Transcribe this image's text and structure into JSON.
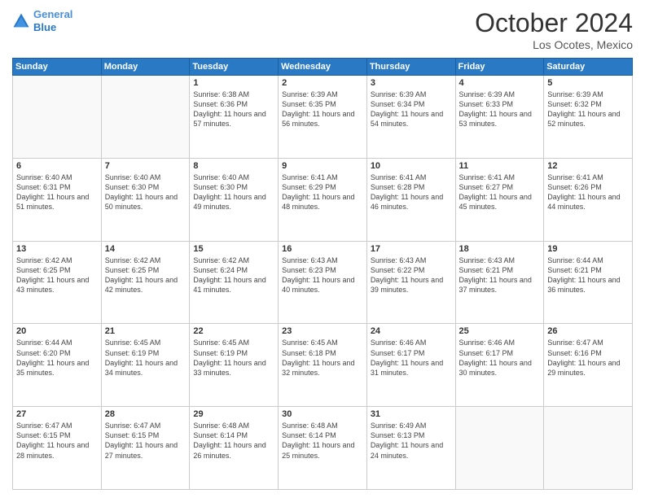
{
  "logo": {
    "line1": "General",
    "line2": "Blue"
  },
  "title": "October 2024",
  "location": "Los Ocotes, Mexico",
  "headers": [
    "Sunday",
    "Monday",
    "Tuesday",
    "Wednesday",
    "Thursday",
    "Friday",
    "Saturday"
  ],
  "weeks": [
    [
      {
        "day": "",
        "info": ""
      },
      {
        "day": "",
        "info": ""
      },
      {
        "day": "1",
        "info": "Sunrise: 6:38 AM\nSunset: 6:36 PM\nDaylight: 11 hours and 57 minutes."
      },
      {
        "day": "2",
        "info": "Sunrise: 6:39 AM\nSunset: 6:35 PM\nDaylight: 11 hours and 56 minutes."
      },
      {
        "day": "3",
        "info": "Sunrise: 6:39 AM\nSunset: 6:34 PM\nDaylight: 11 hours and 54 minutes."
      },
      {
        "day": "4",
        "info": "Sunrise: 6:39 AM\nSunset: 6:33 PM\nDaylight: 11 hours and 53 minutes."
      },
      {
        "day": "5",
        "info": "Sunrise: 6:39 AM\nSunset: 6:32 PM\nDaylight: 11 hours and 52 minutes."
      }
    ],
    [
      {
        "day": "6",
        "info": "Sunrise: 6:40 AM\nSunset: 6:31 PM\nDaylight: 11 hours and 51 minutes."
      },
      {
        "day": "7",
        "info": "Sunrise: 6:40 AM\nSunset: 6:30 PM\nDaylight: 11 hours and 50 minutes."
      },
      {
        "day": "8",
        "info": "Sunrise: 6:40 AM\nSunset: 6:30 PM\nDaylight: 11 hours and 49 minutes."
      },
      {
        "day": "9",
        "info": "Sunrise: 6:41 AM\nSunset: 6:29 PM\nDaylight: 11 hours and 48 minutes."
      },
      {
        "day": "10",
        "info": "Sunrise: 6:41 AM\nSunset: 6:28 PM\nDaylight: 11 hours and 46 minutes."
      },
      {
        "day": "11",
        "info": "Sunrise: 6:41 AM\nSunset: 6:27 PM\nDaylight: 11 hours and 45 minutes."
      },
      {
        "day": "12",
        "info": "Sunrise: 6:41 AM\nSunset: 6:26 PM\nDaylight: 11 hours and 44 minutes."
      }
    ],
    [
      {
        "day": "13",
        "info": "Sunrise: 6:42 AM\nSunset: 6:25 PM\nDaylight: 11 hours and 43 minutes."
      },
      {
        "day": "14",
        "info": "Sunrise: 6:42 AM\nSunset: 6:25 PM\nDaylight: 11 hours and 42 minutes."
      },
      {
        "day": "15",
        "info": "Sunrise: 6:42 AM\nSunset: 6:24 PM\nDaylight: 11 hours and 41 minutes."
      },
      {
        "day": "16",
        "info": "Sunrise: 6:43 AM\nSunset: 6:23 PM\nDaylight: 11 hours and 40 minutes."
      },
      {
        "day": "17",
        "info": "Sunrise: 6:43 AM\nSunset: 6:22 PM\nDaylight: 11 hours and 39 minutes."
      },
      {
        "day": "18",
        "info": "Sunrise: 6:43 AM\nSunset: 6:21 PM\nDaylight: 11 hours and 37 minutes."
      },
      {
        "day": "19",
        "info": "Sunrise: 6:44 AM\nSunset: 6:21 PM\nDaylight: 11 hours and 36 minutes."
      }
    ],
    [
      {
        "day": "20",
        "info": "Sunrise: 6:44 AM\nSunset: 6:20 PM\nDaylight: 11 hours and 35 minutes."
      },
      {
        "day": "21",
        "info": "Sunrise: 6:45 AM\nSunset: 6:19 PM\nDaylight: 11 hours and 34 minutes."
      },
      {
        "day": "22",
        "info": "Sunrise: 6:45 AM\nSunset: 6:19 PM\nDaylight: 11 hours and 33 minutes."
      },
      {
        "day": "23",
        "info": "Sunrise: 6:45 AM\nSunset: 6:18 PM\nDaylight: 11 hours and 32 minutes."
      },
      {
        "day": "24",
        "info": "Sunrise: 6:46 AM\nSunset: 6:17 PM\nDaylight: 11 hours and 31 minutes."
      },
      {
        "day": "25",
        "info": "Sunrise: 6:46 AM\nSunset: 6:17 PM\nDaylight: 11 hours and 30 minutes."
      },
      {
        "day": "26",
        "info": "Sunrise: 6:47 AM\nSunset: 6:16 PM\nDaylight: 11 hours and 29 minutes."
      }
    ],
    [
      {
        "day": "27",
        "info": "Sunrise: 6:47 AM\nSunset: 6:15 PM\nDaylight: 11 hours and 28 minutes."
      },
      {
        "day": "28",
        "info": "Sunrise: 6:47 AM\nSunset: 6:15 PM\nDaylight: 11 hours and 27 minutes."
      },
      {
        "day": "29",
        "info": "Sunrise: 6:48 AM\nSunset: 6:14 PM\nDaylight: 11 hours and 26 minutes."
      },
      {
        "day": "30",
        "info": "Sunrise: 6:48 AM\nSunset: 6:14 PM\nDaylight: 11 hours and 25 minutes."
      },
      {
        "day": "31",
        "info": "Sunrise: 6:49 AM\nSunset: 6:13 PM\nDaylight: 11 hours and 24 minutes."
      },
      {
        "day": "",
        "info": ""
      },
      {
        "day": "",
        "info": ""
      }
    ]
  ]
}
